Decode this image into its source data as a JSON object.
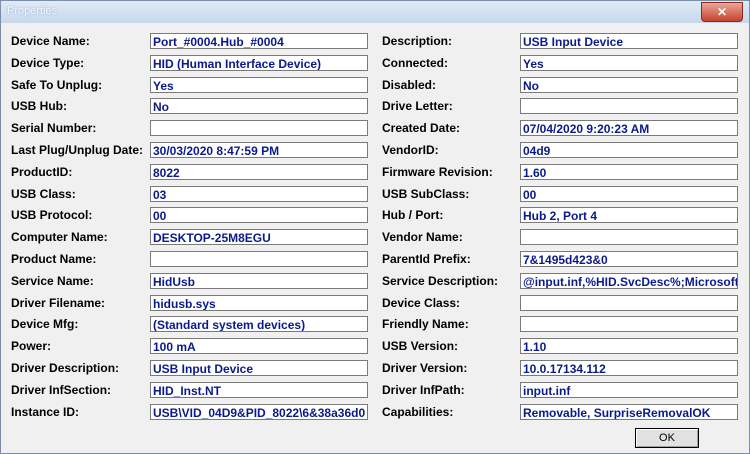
{
  "window": {
    "title": "Properties",
    "close_label": "✕",
    "ok_label": "OK"
  },
  "left": [
    {
      "label": "Device Name:",
      "value": "Port_#0004.Hub_#0004"
    },
    {
      "label": "Device Type:",
      "value": "HID (Human Interface Device)"
    },
    {
      "label": "Safe To Unplug:",
      "value": "Yes"
    },
    {
      "label": "USB Hub:",
      "value": "No"
    },
    {
      "label": "Serial Number:",
      "value": ""
    },
    {
      "label": "Last Plug/Unplug Date:",
      "value": "30/03/2020 8:47:59 PM"
    },
    {
      "label": "ProductID:",
      "value": "8022"
    },
    {
      "label": "USB Class:",
      "value": "03"
    },
    {
      "label": "USB Protocol:",
      "value": "00"
    },
    {
      "label": "Computer Name:",
      "value": "DESKTOP-25M8EGU"
    },
    {
      "label": "Product Name:",
      "value": ""
    },
    {
      "label": "Service Name:",
      "value": "HidUsb"
    },
    {
      "label": "Driver Filename:",
      "value": "hidusb.sys"
    },
    {
      "label": "Device Mfg:",
      "value": "(Standard system devices)"
    },
    {
      "label": "Power:",
      "value": "100 mA"
    },
    {
      "label": "Driver Description:",
      "value": "USB Input Device"
    },
    {
      "label": "Driver InfSection:",
      "value": "HID_Inst.NT"
    },
    {
      "label": "Instance ID:",
      "value": "USB\\VID_04D9&PID_8022\\6&38a36d0"
    }
  ],
  "right": [
    {
      "label": "Description:",
      "value": "USB Input Device"
    },
    {
      "label": "Connected:",
      "value": "Yes"
    },
    {
      "label": "Disabled:",
      "value": "No"
    },
    {
      "label": "Drive Letter:",
      "value": ""
    },
    {
      "label": "Created Date:",
      "value": "07/04/2020 9:20:23 AM"
    },
    {
      "label": "VendorID:",
      "value": "04d9"
    },
    {
      "label": "Firmware Revision:",
      "value": "1.60"
    },
    {
      "label": "USB SubClass:",
      "value": "00"
    },
    {
      "label": "Hub / Port:",
      "value": "Hub 2, Port 4"
    },
    {
      "label": "Vendor Name:",
      "value": ""
    },
    {
      "label": "ParentId Prefix:",
      "value": "7&1495d423&0"
    },
    {
      "label": "Service Description:",
      "value": "@input.inf,%HID.SvcDesc%;Microsoft"
    },
    {
      "label": "Device Class:",
      "value": ""
    },
    {
      "label": "Friendly Name:",
      "value": ""
    },
    {
      "label": "USB Version:",
      "value": "1.10"
    },
    {
      "label": "Driver Version:",
      "value": "10.0.17134.112"
    },
    {
      "label": "Driver InfPath:",
      "value": "input.inf"
    },
    {
      "label": "Capabilities:",
      "value": "Removable, SurpriseRemovalOK"
    }
  ]
}
